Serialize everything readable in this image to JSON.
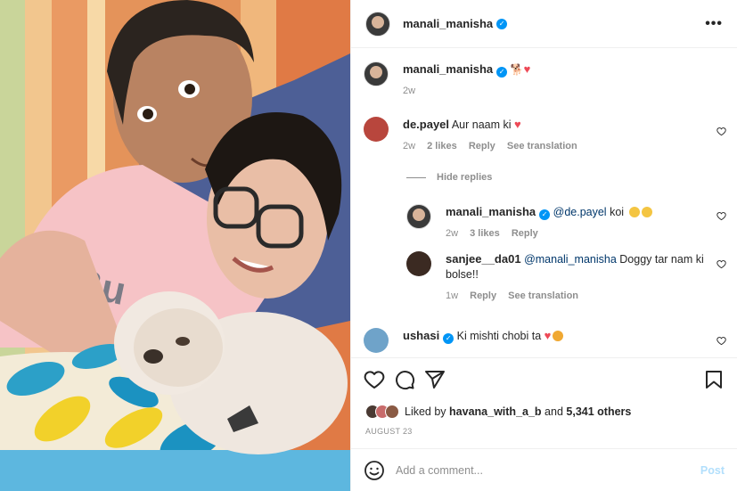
{
  "post": {
    "author": "manali_manisha",
    "verified": true,
    "more_icon": "more-horizontal-icon"
  },
  "caption": {
    "username": "manali_manisha",
    "emoji": [
      "dog-emoji",
      "red-heart-emoji"
    ],
    "age": "2w"
  },
  "comments": [
    {
      "username": "de.payel",
      "text": "Aur naam ki",
      "emoji": [
        "red-heart-emoji"
      ],
      "age": "2w",
      "likes": "2 likes",
      "reply": "Reply",
      "translate": "See translation"
    }
  ],
  "hide_replies": "Hide replies",
  "replies": [
    {
      "username": "manali_manisha",
      "verified": true,
      "mention": "@de.payel",
      "text": "koi",
      "emoji": [
        "smiling-face-emoji",
        "smiling-face-emoji"
      ],
      "age": "2w",
      "likes": "3 likes",
      "reply": "Reply"
    },
    {
      "username": "sanjee__da01",
      "mention": "@manali_manisha",
      "text": "Doggy tar nam ki bolse!!",
      "age": "1w",
      "reply": "Reply",
      "translate": "See translation"
    }
  ],
  "last_comment": {
    "username": "ushasi",
    "verified": true,
    "text": "Ki mishti chobi ta",
    "emoji": [
      "red-heart-emoji",
      "star-struck-emoji"
    ]
  },
  "actions": [
    "heart-icon",
    "comment-icon",
    "share-icon",
    "bookmark-icon"
  ],
  "likes": {
    "prefix": "Liked by",
    "user": "havana_with_a_b",
    "middle": "and",
    "count": "5,341 others"
  },
  "date": "AUGUST 23",
  "add_comment": {
    "placeholder": "Add a comment...",
    "post_label": "Post"
  },
  "colors": {
    "accent": "#0095f6",
    "post_disabled": "#b2dffc",
    "like_red": "#ed4956",
    "muted": "#8e8e8e"
  }
}
